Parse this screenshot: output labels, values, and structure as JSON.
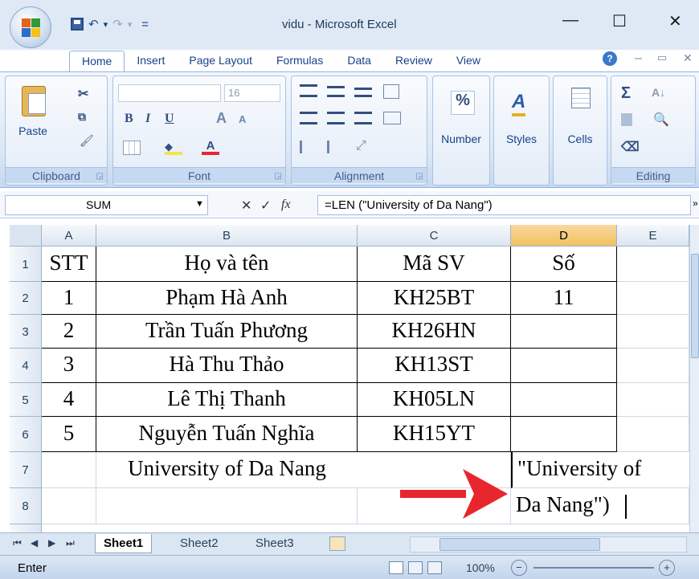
{
  "window": {
    "title": "vidu - Microsoft Excel",
    "minimize": "—",
    "maximize": "☐",
    "close": "✕"
  },
  "qat": {
    "undo": "↶",
    "redo": "↷",
    "dropdown": "▾",
    "customize": "="
  },
  "tabs": [
    "Home",
    "Insert",
    "Page Layout",
    "Formulas",
    "Data",
    "Review",
    "View"
  ],
  "ribbon": {
    "clipboard": {
      "label": "Clipboard",
      "paste": "Paste"
    },
    "font": {
      "label": "Font",
      "size": "16",
      "bold": "B",
      "italic": "I",
      "underline": "U",
      "grow": "A",
      "shrink": "A"
    },
    "alignment": {
      "label": "Alignment"
    },
    "number": {
      "label": "Number",
      "symbol": "%"
    },
    "styles": {
      "label": "Styles"
    },
    "cells": {
      "label": "Cells"
    },
    "editing": {
      "label": "Editing",
      "sum": "Σ",
      "sort": "A↓",
      "find": "🔭"
    }
  },
  "formula_bar": {
    "name_box": "SUM",
    "formula": "=LEN (\"University of Da Nang\")",
    "fx": "fx",
    "cancel": "✕",
    "enter": "✓"
  },
  "columns": [
    "A",
    "B",
    "C",
    "D",
    "E"
  ],
  "selected_column": "D",
  "rows": [
    {
      "num": "1",
      "A": "STT",
      "B": "Họ và tên",
      "C": "Mã SV",
      "D": "Số"
    },
    {
      "num": "2",
      "A": "1",
      "B": "Phạm Hà Anh",
      "C": "KH25BT",
      "D": "11"
    },
    {
      "num": "3",
      "A": "2",
      "B": "Trần Tuấn Phương",
      "C": "KH26HN",
      "D": ""
    },
    {
      "num": "4",
      "A": "3",
      "B": "Hà Thu Thảo",
      "C": "KH13ST",
      "D": ""
    },
    {
      "num": "5",
      "A": "4",
      "B": "Lê Thị Thanh",
      "C": "KH05LN",
      "D": ""
    },
    {
      "num": "6",
      "A": "5",
      "B": "Nguyễn Tuấn Nghĩa",
      "C": "KH15YT",
      "D": ""
    },
    {
      "num": "7",
      "A": "",
      "B": "University of Da Nang",
      "C": "",
      "D": "\"University of"
    },
    {
      "num": "8",
      "A": "",
      "B": "",
      "C": "",
      "D": "Da Nang\")"
    }
  ],
  "sheets": [
    "Sheet1",
    "Sheet2",
    "Sheet3"
  ],
  "active_sheet": "Sheet1",
  "status": {
    "mode": "Enter",
    "zoom": "100%"
  },
  "colors": {
    "accent": "#15428b",
    "arrow": "#e8262d",
    "selected_header": "#f1c15f"
  }
}
